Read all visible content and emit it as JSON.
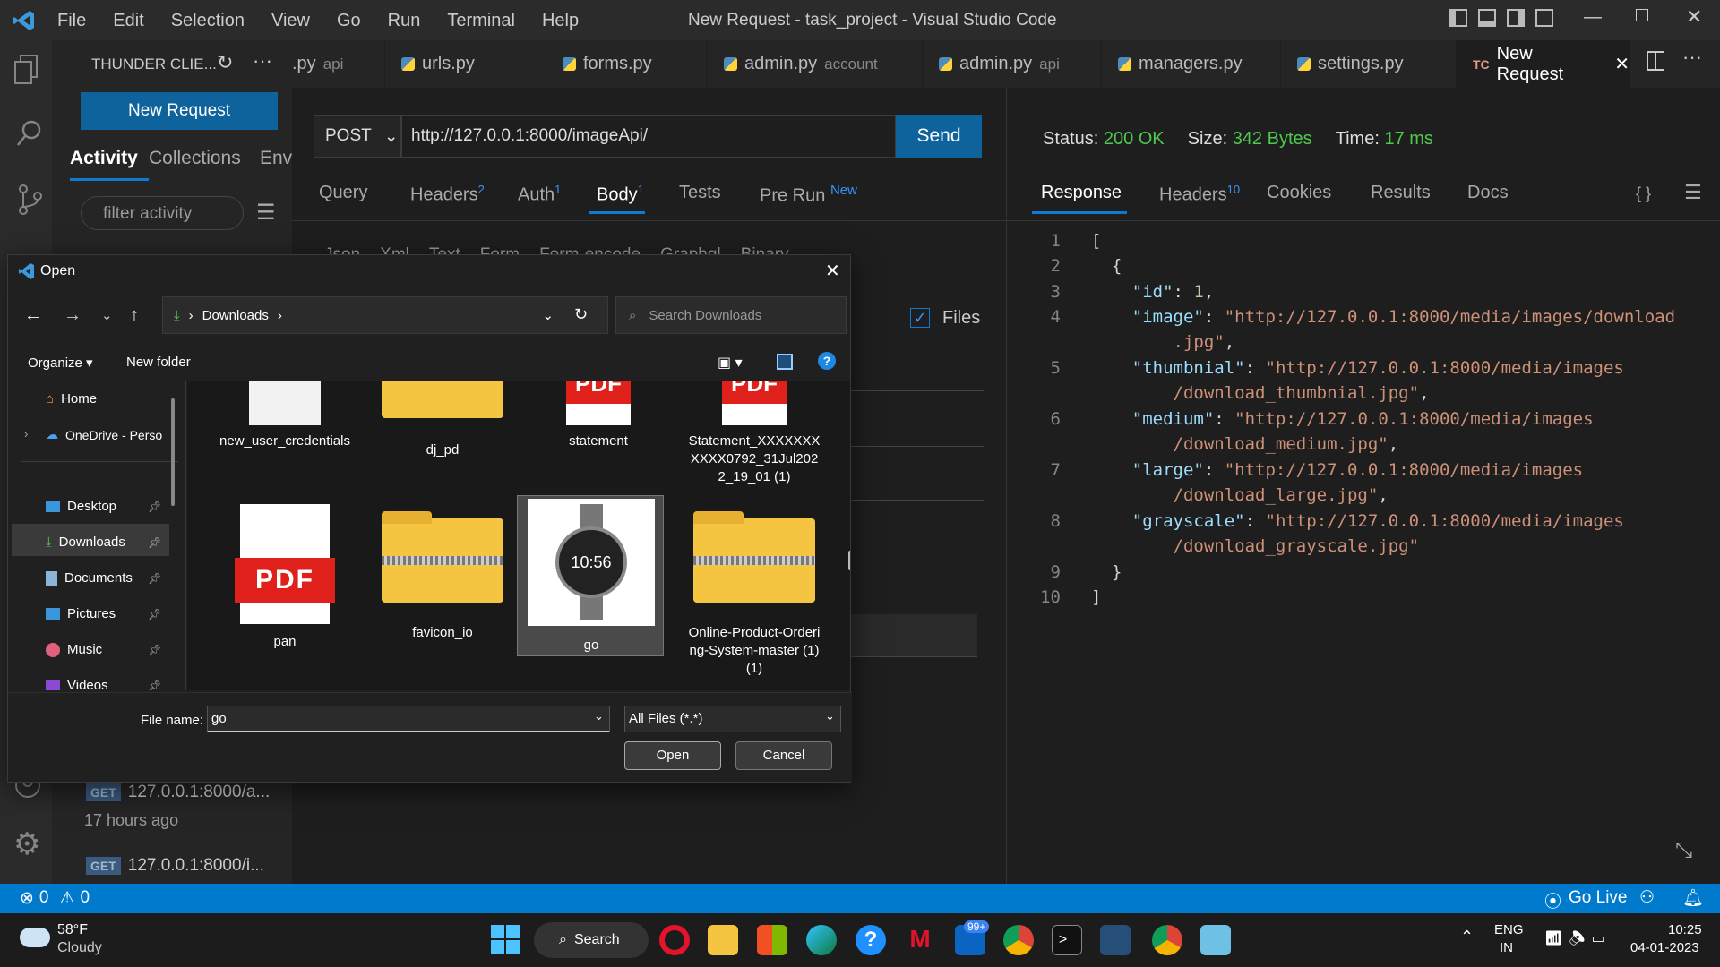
{
  "window": {
    "title": "New Request - task_project - Visual Studio Code",
    "menu": [
      "File",
      "Edit",
      "Selection",
      "View",
      "Go",
      "Run",
      "Terminal",
      "Help"
    ]
  },
  "sidebar": {
    "header": "THUNDER CLIE...",
    "new_request": "New Request",
    "tabs": [
      "Activity",
      "Collections",
      "Env"
    ],
    "filter_placeholder": "filter activity",
    "history": [
      {
        "method": "GET",
        "url": "127.0.0.1:8000/a...",
        "time": "17 hours ago"
      },
      {
        "method": "GET",
        "url": "127.0.0.1:8000/i..."
      }
    ]
  },
  "tabs": [
    {
      "name": ".py",
      "dir": "api"
    },
    {
      "name": "urls.py",
      "dir": ""
    },
    {
      "name": "forms.py",
      "dir": ""
    },
    {
      "name": "admin.py",
      "dir": "account"
    },
    {
      "name": "admin.py",
      "dir": "api"
    },
    {
      "name": "managers.py",
      "dir": ""
    },
    {
      "name": "settings.py",
      "dir": ""
    },
    {
      "name": "New Request",
      "dir": "",
      "badge": "TC"
    }
  ],
  "request": {
    "method": "POST",
    "url": "http://127.0.0.1:8000/imageApi/",
    "send": "Send",
    "tabs": [
      {
        "label": "Query"
      },
      {
        "label": "Headers",
        "sup": "2"
      },
      {
        "label": "Auth",
        "sup": "1"
      },
      {
        "label": "Body",
        "sup": "1"
      },
      {
        "label": "Tests"
      },
      {
        "label": "Pre Run",
        "sup": "New"
      }
    ],
    "body_tabs": [
      "Json",
      "Xml",
      "Text",
      "Form",
      "Form-encode",
      "Graphql",
      "Binary"
    ],
    "files_label": "Files"
  },
  "response": {
    "status_label": "Status:",
    "status": "200 OK",
    "size_label": "Size:",
    "size": "342 Bytes",
    "time_label": "Time:",
    "time": "17 ms",
    "tabs": [
      {
        "label": "Response"
      },
      {
        "label": "Headers",
        "sup": "10"
      },
      {
        "label": "Cookies"
      },
      {
        "label": "Results"
      },
      {
        "label": "Docs"
      }
    ],
    "lines": [
      "1",
      "2",
      "3",
      "4",
      "5",
      "6",
      "7",
      "8",
      "9",
      "10"
    ],
    "json": {
      "id_key": "\"id\"",
      "id_val": "1",
      "image_key": "\"image\"",
      "image_val1": "\"http://127.0.0.1:8000/media/images/download",
      "image_val2": ".jpg\"",
      "thumb_key": "\"thumbnial\"",
      "thumb_val1": "\"http://127.0.0.1:8000/media/images",
      "thumb_val2": "/download_thumbnial.jpg\"",
      "medium_key": "\"medium\"",
      "medium_val1": "\"http://127.0.0.1:8000/media/images",
      "medium_val2": "/download_medium.jpg\"",
      "large_key": "\"large\"",
      "large_val1": "\"http://127.0.0.1:8000/media/images",
      "large_val2": "/download_large.jpg\"",
      "gray_key": "\"grayscale\"",
      "gray_val1": "\"http://127.0.0.1:8000/media/images",
      "gray_val2": "/download_grayscale.jpg\""
    }
  },
  "dialog": {
    "title": "Open",
    "path": "Downloads",
    "search_placeholder": "Search Downloads",
    "organize": "Organize",
    "new_folder": "New folder",
    "nav": [
      {
        "label": "Home"
      },
      {
        "label": "OneDrive - Perso"
      },
      {
        "label": "Desktop"
      },
      {
        "label": "Downloads"
      },
      {
        "label": "Documents"
      },
      {
        "label": "Pictures"
      },
      {
        "label": "Music"
      },
      {
        "label": "Videos"
      }
    ],
    "files": [
      "new_user_credentials",
      "dj_pd",
      "statement",
      "Statement_XXXXXXXXXXX0792_31Jul2022_19_01 (1)",
      "pan",
      "favicon_io",
      "go",
      "Online-Product-Ordering-System-master (1) (1)"
    ],
    "file_name_label": "File name:",
    "file_name": "go",
    "file_type": "All Files (*.*)",
    "open": "Open",
    "cancel": "Cancel",
    "watch_time": "10:56"
  },
  "status": {
    "errors": "0",
    "warnings": "0",
    "go_live": "Go Live"
  },
  "taskbar": {
    "temp": "58°F",
    "weather": "Cloudy",
    "search": "Search",
    "badge": "99+",
    "lang1": "ENG",
    "lang2": "IN",
    "time": "10:25",
    "date": "04-01-2023"
  },
  "colors": {
    "accent": "#0e639c",
    "status_ok": "#4ec94e",
    "statusbar": "#007acc"
  }
}
